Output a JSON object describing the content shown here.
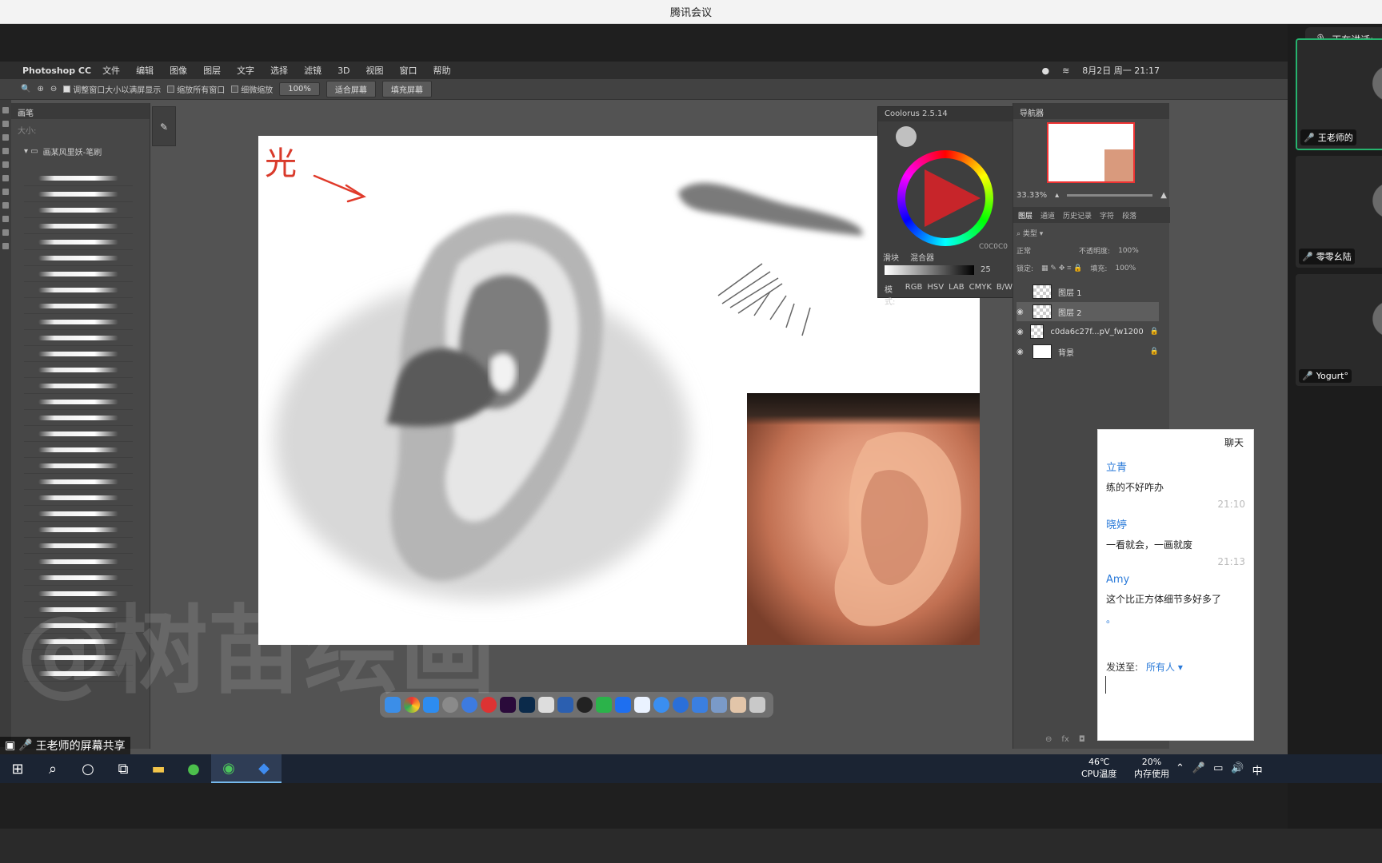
{
  "meeting": {
    "title": "腾讯会议",
    "speaking_label": "正在讲话:",
    "participants": [
      {
        "name": "王老师的"
      },
      {
        "name": "零零幺陆"
      },
      {
        "name": "Yogurt°"
      }
    ],
    "share_label": "王老师的屏幕共享"
  },
  "mac_menubar": {
    "app": "Photoshop CC",
    "menus": [
      "文件",
      "编辑",
      "图像",
      "图层",
      "文字",
      "选择",
      "滤镜",
      "3D",
      "视图",
      "窗口",
      "帮助"
    ],
    "datetime": "8月2日 周一 21:17"
  },
  "options_bar": {
    "check1": "调整窗口大小以满屏显示",
    "check2": "缩放所有窗口",
    "check3": "细微缩放",
    "zoom_value": "100%",
    "fit_screen": "适合屏幕",
    "fill_screen": "填充屏幕"
  },
  "brush_panel": {
    "tab": "画笔",
    "size_label": "大小:",
    "folder": "画某风里妖-笔刷"
  },
  "canvas": {
    "handwriting": "光"
  },
  "coolorus": {
    "title": "Coolorus 2.5.14",
    "hex": "C0C0C0",
    "tab_sliders": "滑块",
    "tab_mixer": "混合器",
    "slider_value": "25",
    "mode_label": "模式:",
    "modes": [
      "RGB",
      "HSV",
      "LAB",
      "CMYK",
      "B/W"
    ]
  },
  "navigator": {
    "title": "导航器",
    "zoom": "33.33%"
  },
  "layers_panel": {
    "tabs": [
      "图层",
      "通道",
      "历史记录",
      "字符",
      "段落"
    ],
    "filter": "类型",
    "blend_mode": "正常",
    "opacity_label": "不透明度:",
    "opacity": "100%",
    "lock_label": "锁定:",
    "fill_label": "填充:",
    "fill": "100%",
    "layers": [
      {
        "name": "图层 1"
      },
      {
        "name": "图层 2"
      },
      {
        "name": "c0da6c27f...pV_fw1200"
      },
      {
        "name": "背景"
      }
    ]
  },
  "chat": {
    "title": "聊天",
    "messages": [
      {
        "name": "立青",
        "text": "练的不好咋办",
        "time": "21:10"
      },
      {
        "name": "晓婷",
        "text": "一看就会，一画就废",
        "time": "21:13"
      },
      {
        "name": "Amy",
        "text": "这个比正方体细节多好多了",
        "time": ""
      }
    ],
    "extra": "。",
    "send_to_label": "发送至:",
    "send_to_value": "所有人"
  },
  "watermark": "@树苗绘画",
  "taskbar": {
    "cpu_temp": "46℃",
    "cpu_label": "CPU温度",
    "mem_pct": "20%",
    "mem_label": "内存使用",
    "ime": "中"
  }
}
